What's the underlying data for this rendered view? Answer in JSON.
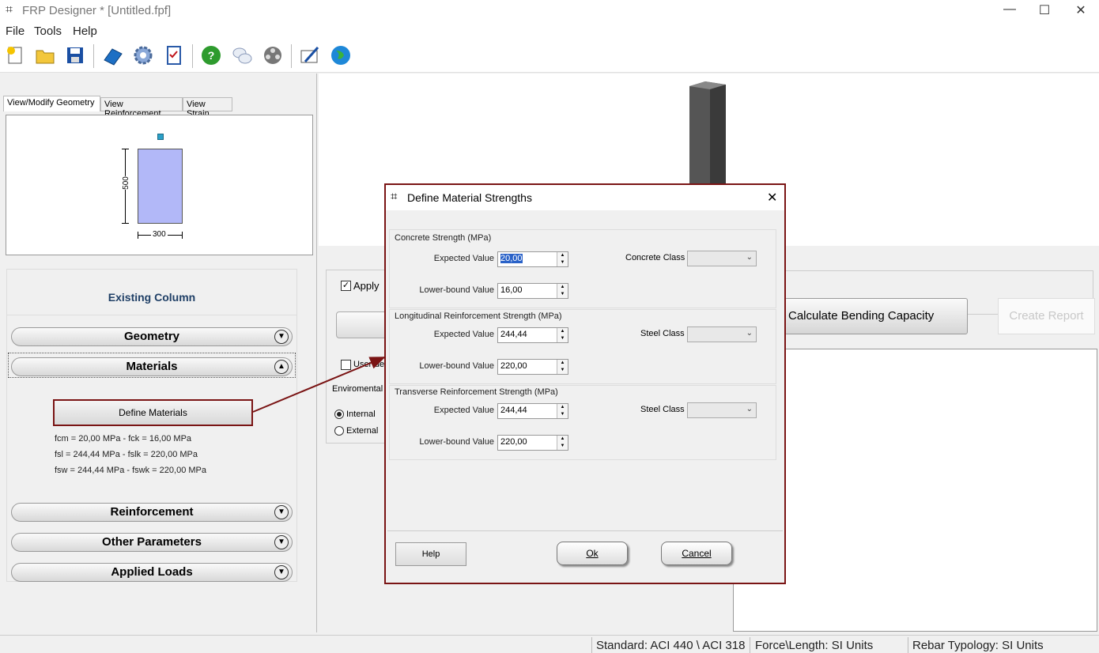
{
  "window": {
    "title": "FRP Designer * [Untitled.fpf]"
  },
  "menu": [
    "File",
    "Tools",
    "Help"
  ],
  "toolbar_icons": [
    "new-file",
    "open-folder",
    "save-disk",
    "manual-book",
    "settings-gear",
    "checklist",
    "help-question",
    "chat-bubbles",
    "film-reel",
    "email-pen",
    "globe"
  ],
  "tabs": [
    "View/Modify Geometry",
    "View Reinforcement",
    "View Strain"
  ],
  "geometry": {
    "height_label": "500",
    "width_label": "300"
  },
  "left": {
    "existing_column": "Existing Column",
    "sections": {
      "geometry": "Geometry",
      "materials": "Materials",
      "reinforcement": "Reinforcement",
      "other": "Other Parameters",
      "loads": "Applied Loads"
    },
    "define_materials": "Define Materials",
    "material_lines": [
      "fcm = 20,00 MPa   -   fck = 16,00 MPa",
      "fsl = 244,44 MPa   -   fslk = 220,00 MPa",
      "fsw = 244,44 MPa   -   fswk = 220,00 MPa"
    ]
  },
  "right": {
    "apply_label": "Apply",
    "user_label": "User-de",
    "env_label": "Enviromental",
    "internal_label": "Internal",
    "external_label": "External",
    "calc_label": "Calculate Bending Capacity",
    "report_label": "Create Report"
  },
  "dialog": {
    "title": "Define Material Strengths",
    "concrete": {
      "title": "Concrete Strength (MPa)",
      "expected_label": "Expected Value",
      "expected_value": "20,00",
      "lower_label": "Lower-bound Value",
      "lower_value": "16,00",
      "class_label": "Concrete Class"
    },
    "longitudinal": {
      "title": "Longitudinal Reinforcement Strength (MPa)",
      "expected_label": "Expected Value",
      "expected_value": "244,44",
      "lower_label": "Lower-bound Value",
      "lower_value": "220,00",
      "class_label": "Steel Class"
    },
    "transverse": {
      "title": "Transverse Reinforcement Strength (MPa)",
      "expected_label": "Expected Value",
      "expected_value": "244,44",
      "lower_label": "Lower-bound Value",
      "lower_value": "220,00",
      "class_label": "Steel Class"
    },
    "help_label": "Help",
    "ok_label": "Ok",
    "cancel_label": "Cancel"
  },
  "status": {
    "standard": "Standard: ACI 440 \\ ACI 318",
    "units": "Force\\Length: SI Units",
    "rebar": "Rebar Typology: SI Units"
  }
}
